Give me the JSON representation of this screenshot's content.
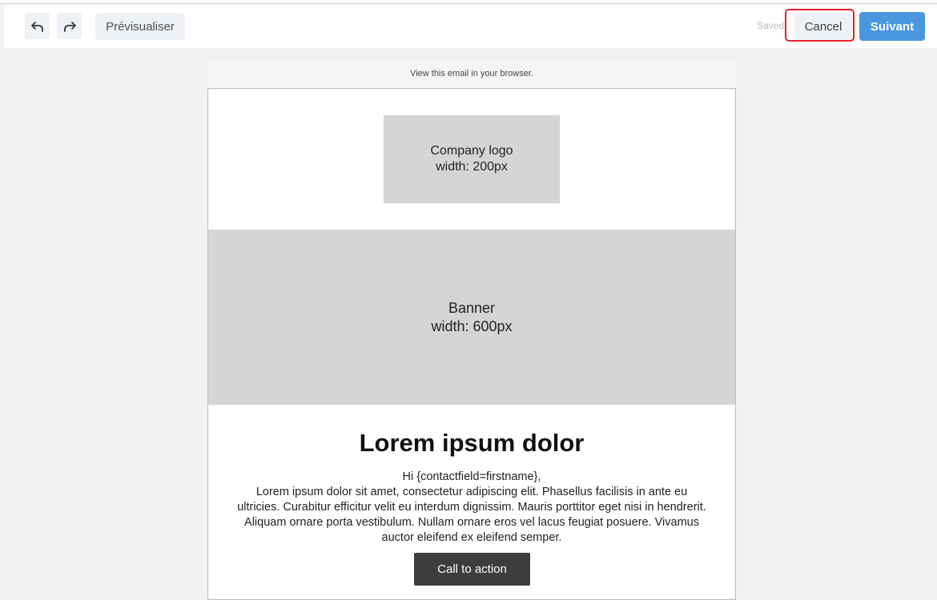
{
  "toolbar": {
    "undo_icon": "undo-icon",
    "redo_icon": "redo-icon",
    "preview_label": "Prévisualiser",
    "saved_label": "Saved",
    "cancel_label": "Cancel",
    "next_label": "Suivant"
  },
  "email": {
    "browser_link": "View this email in your browser.",
    "logo_line1": "Company logo",
    "logo_line2": "width: 200px",
    "banner_line1": "Banner",
    "banner_line2": "width: 600px",
    "headline": "Lorem ipsum dolor",
    "greeting": "Hi {contactfield=firstname},",
    "body": "Lorem ipsum dolor sit amet, consectetur adipiscing elit. Phasellus facilisis in ante eu ultricies. Curabitur efficitur velit eu interdum dignissim. Mauris porttitor eget nisi in hendrerit. Aliquam ornare porta vestibulum. Nullam ornare eros vel lacus feugiat posuere. Vivamus auctor eleifend ex eleifend semper.",
    "cta_label": "Call to action"
  },
  "colors": {
    "primary": "#4a97df",
    "highlight": "#e8202a",
    "placeholder_gray": "#d5d5d5",
    "cta_bg": "#3d3d3d"
  }
}
